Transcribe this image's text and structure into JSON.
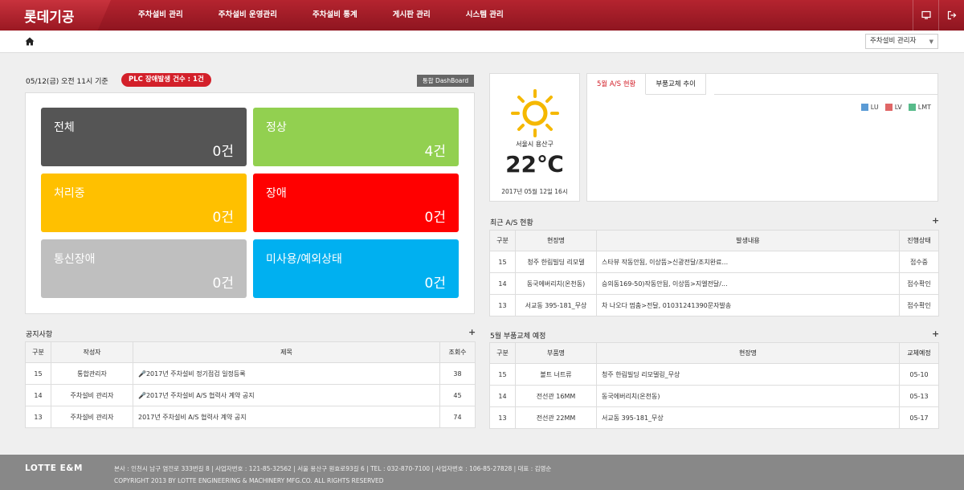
{
  "header": {
    "logo": "롯데기공",
    "nav": [
      "주차설비 관리",
      "주차설비 운영관리",
      "주차설비 통계",
      "게시판 관리",
      "시스템 관리"
    ],
    "icons": [
      "monitor-icon",
      "logout-icon"
    ]
  },
  "breadcrumb": {
    "icon": "home-icon"
  },
  "role_select": {
    "value": "주차설비 관리자"
  },
  "status": {
    "date_label": "05/12(금) 오전 11시 기준",
    "plc_badge": "PLC 장애발생 건수 : 1건",
    "dashboard_button": "통합 DashBoard",
    "tiles": [
      {
        "label": "전체",
        "count": "0건",
        "color": "#555555"
      },
      {
        "label": "정상",
        "count": "4건",
        "color": "#92d050"
      },
      {
        "label": "처리중",
        "count": "0건",
        "color": "#ffc000"
      },
      {
        "label": "장애",
        "count": "0건",
        "color": "#ff0000"
      },
      {
        "label": "통신장애",
        "count": "0건",
        "color": "#bfbfbf"
      },
      {
        "label": "미사용/예외상태",
        "count": "0건",
        "color": "#00b0f0"
      }
    ]
  },
  "weather": {
    "icon": "sun-icon",
    "location": "서울시 용산구",
    "temperature": "22℃",
    "datetime": "2017년 05월 12일 16시"
  },
  "chart_panel": {
    "tabs": [
      "5월 A/S 현황",
      "부품교체 추이"
    ],
    "active_tab": 0,
    "legend": [
      {
        "name": "LU",
        "color": "#5b9bd5"
      },
      {
        "name": "LV",
        "color": "#e06666"
      },
      {
        "name": "LMT",
        "color": "#57bb8a"
      }
    ]
  },
  "notice": {
    "title": "공지사항",
    "plus": "+",
    "columns": [
      "구분",
      "작성자",
      "제목",
      "조회수"
    ],
    "rows": [
      {
        "no": "15",
        "author": "통합관리자",
        "subject": "2017년 주차설비 정기점검 일정등록",
        "views": "38",
        "mic": true
      },
      {
        "no": "14",
        "author": "주차설비 관리자",
        "subject": "2017년 주차설비 A/S 협력사 계약 공지",
        "views": "45",
        "mic": true
      },
      {
        "no": "13",
        "author": "주차설비 관리자",
        "subject": "2017년 주차설비 A/S 협력사 계약 공지",
        "views": "74",
        "mic": false
      }
    ]
  },
  "recent_as": {
    "title": "최근 A/S 현황",
    "plus": "+",
    "columns": [
      "구분",
      "현장명",
      "발생내용",
      "진행상태"
    ],
    "rows": [
      {
        "no": "15",
        "site": "청주 한림빌딩 리모델",
        "content": "스타뷰 작동안됨, 이상뜸>신광전달/조치완료...",
        "status": "접수중"
      },
      {
        "no": "14",
        "site": "동국에버리치(온천동)",
        "content": "승의동169-50)작동안됨, 이상뜸>지엘전달/...",
        "status": "접수확인"
      },
      {
        "no": "13",
        "site": "서교동 395-181_무상",
        "content": "차 나오다 멈춤>전달, 01031241390문자발송",
        "status": "접수확인"
      }
    ]
  },
  "parts": {
    "title": "5월 부품교체 예정",
    "plus": "+",
    "columns": [
      "구분",
      "부품명",
      "현장명",
      "교체예정"
    ],
    "rows": [
      {
        "no": "15",
        "part": "볼트 너트류",
        "site": "청주 한림빌딩 리모델링_무상",
        "date": "05-10"
      },
      {
        "no": "14",
        "part": "전선관 16MM",
        "site": "동국에버리치(온천동)",
        "date": "05-13"
      },
      {
        "no": "13",
        "part": "전선관 22MM",
        "site": "서교동 395-181_무상",
        "date": "05-17"
      }
    ]
  },
  "footer": {
    "logo": "LOTTE E&M",
    "address": "본사 : 인천시 남구 염전로 333번길 8 | 사업자번호 : 121-85-32562 | 서울 용산구 원효로93길 6 | TEL : 032-870-7100 | 사업자번호 : 106-85-27828 | 대표 : 김영순",
    "copyright": "COPYRIGHT 2013 BY LOTTE ENGINEERING & MACHINERY MFG.CO. ALL RIGHTS RESERVED"
  }
}
